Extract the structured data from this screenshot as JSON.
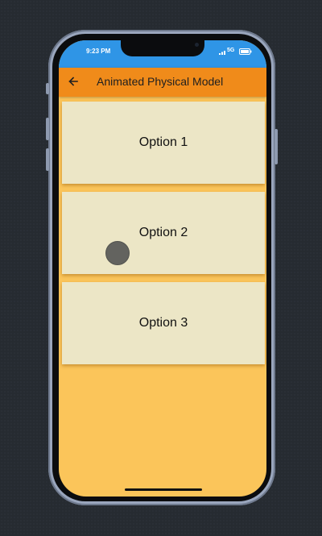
{
  "status_bar": {
    "time": "9:23 PM",
    "network": "5G",
    "color": "#2f95e6"
  },
  "app_bar": {
    "title": "Animated Physical Model",
    "back_icon": "arrow-left-icon",
    "color": "#f08b1a"
  },
  "options": [
    {
      "label": "Option 1"
    },
    {
      "label": "Option 2"
    },
    {
      "label": "Option 3"
    }
  ],
  "colors": {
    "screen_background": "#fbc55a",
    "card_background": "#ece6c6"
  }
}
